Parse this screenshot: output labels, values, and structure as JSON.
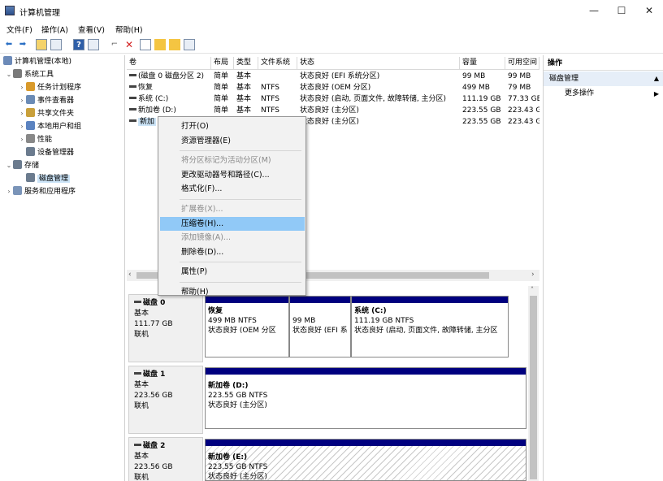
{
  "window": {
    "title": "计算机管理",
    "minimize": "—",
    "maximize": "☐",
    "close": "✕"
  },
  "menubar": [
    "文件(F)",
    "操作(A)",
    "查看(V)",
    "帮助(H)"
  ],
  "tree": {
    "root": "计算机管理(本地)",
    "items": [
      {
        "label": "系统工具",
        "level": 1,
        "arrow": "⌄",
        "icon": "tools-icon"
      },
      {
        "label": "任务计划程序",
        "level": 2,
        "arrow": "›",
        "icon": "clock-icon"
      },
      {
        "label": "事件查看器",
        "level": 2,
        "arrow": "›",
        "icon": "event-icon"
      },
      {
        "label": "共享文件夹",
        "level": 2,
        "arrow": "›",
        "icon": "share-icon"
      },
      {
        "label": "本地用户和组",
        "level": 2,
        "arrow": "›",
        "icon": "users-icon"
      },
      {
        "label": "性能",
        "level": 2,
        "arrow": "›",
        "icon": "perf-icon"
      },
      {
        "label": "设备管理器",
        "level": 2,
        "arrow": "",
        "icon": "device-icon"
      },
      {
        "label": "存储",
        "level": 1,
        "arrow": "⌄",
        "icon": "storage-icon"
      },
      {
        "label": "磁盘管理",
        "level": 2,
        "arrow": "",
        "icon": "disk-icon",
        "selected": true
      },
      {
        "label": "服务和应用程序",
        "level": 1,
        "arrow": "›",
        "icon": "services-icon"
      }
    ]
  },
  "volume_list": {
    "columns": [
      "卷",
      "布局",
      "类型",
      "文件系统",
      "状态",
      "容量",
      "可用空间"
    ],
    "rows": [
      [
        "(磁盘 0 磁盘分区 2)",
        "简单",
        "基本",
        "",
        "状态良好 (EFI 系统分区)",
        "99 MB",
        "99 MB"
      ],
      [
        "恢复",
        "简单",
        "基本",
        "NTFS",
        "状态良好 (OEM 分区)",
        "499 MB",
        "79 MB"
      ],
      [
        "系统 (C:)",
        "简单",
        "基本",
        "NTFS",
        "状态良好 (启动, 页面文件, 故障转储, 主分区)",
        "111.19 GB",
        "77.33 GB"
      ],
      [
        "新加卷 (D:)",
        "简单",
        "基本",
        "NTFS",
        "状态良好 (主分区)",
        "223.55 GB",
        "223.43 GB"
      ],
      [
        "新加",
        "",
        "",
        "",
        "状态良好 (主分区)",
        "223.55 GB",
        "223.43 GB"
      ]
    ]
  },
  "context_menu": [
    {
      "label": "打开(O)",
      "disabled": false
    },
    {
      "label": "资源管理器(E)",
      "disabled": false
    },
    {
      "sep": true
    },
    {
      "label": "将分区标记为活动分区(M)",
      "disabled": true
    },
    {
      "label": "更改驱动器号和路径(C)...",
      "disabled": false
    },
    {
      "label": "格式化(F)...",
      "disabled": false
    },
    {
      "sep": true
    },
    {
      "label": "扩展卷(X)...",
      "disabled": true
    },
    {
      "label": "压缩卷(H)...",
      "disabled": false,
      "highlighted": true
    },
    {
      "label": "添加镜像(A)...",
      "disabled": true
    },
    {
      "label": "删除卷(D)...",
      "disabled": false
    },
    {
      "sep": true
    },
    {
      "label": "属性(P)",
      "disabled": false
    },
    {
      "sep": true
    },
    {
      "label": "帮助(H)",
      "disabled": false
    }
  ],
  "disks": [
    {
      "name": "磁盘 0",
      "type": "基本",
      "size": "111.77 GB",
      "status": "联机",
      "partitions": [
        {
          "title": "恢复",
          "size": "499 MB NTFS",
          "status": "状态良好 (OEM 分区"
        },
        {
          "title": "",
          "size": "99 MB",
          "status": "状态良好 (EFI 系"
        },
        {
          "title": "系统 (C:)",
          "size": "111.19 GB NTFS",
          "status": "状态良好 (启动, 页面文件, 故障转储, 主分区"
        }
      ]
    },
    {
      "name": "磁盘 1",
      "type": "基本",
      "size": "223.56 GB",
      "status": "联机",
      "partitions": [
        {
          "title": "新加卷 (D:)",
          "size": "223.55 GB NTFS",
          "status": "状态良好 (主分区)"
        }
      ]
    },
    {
      "name": "磁盘 2",
      "type": "基本",
      "size": "223.56 GB",
      "status": "联机",
      "partitions": [
        {
          "title": "新加卷 (E:)",
          "size": "223.55 GB NTFS",
          "status": "状态良好 (主分区)"
        }
      ]
    }
  ],
  "actions": {
    "header": "操作",
    "section": "磁盘管理",
    "more": "更多操作"
  },
  "colors": {
    "selection": "#cce4f7",
    "menu_highlight": "#91c9f7",
    "partition_bar": "#00007f"
  }
}
